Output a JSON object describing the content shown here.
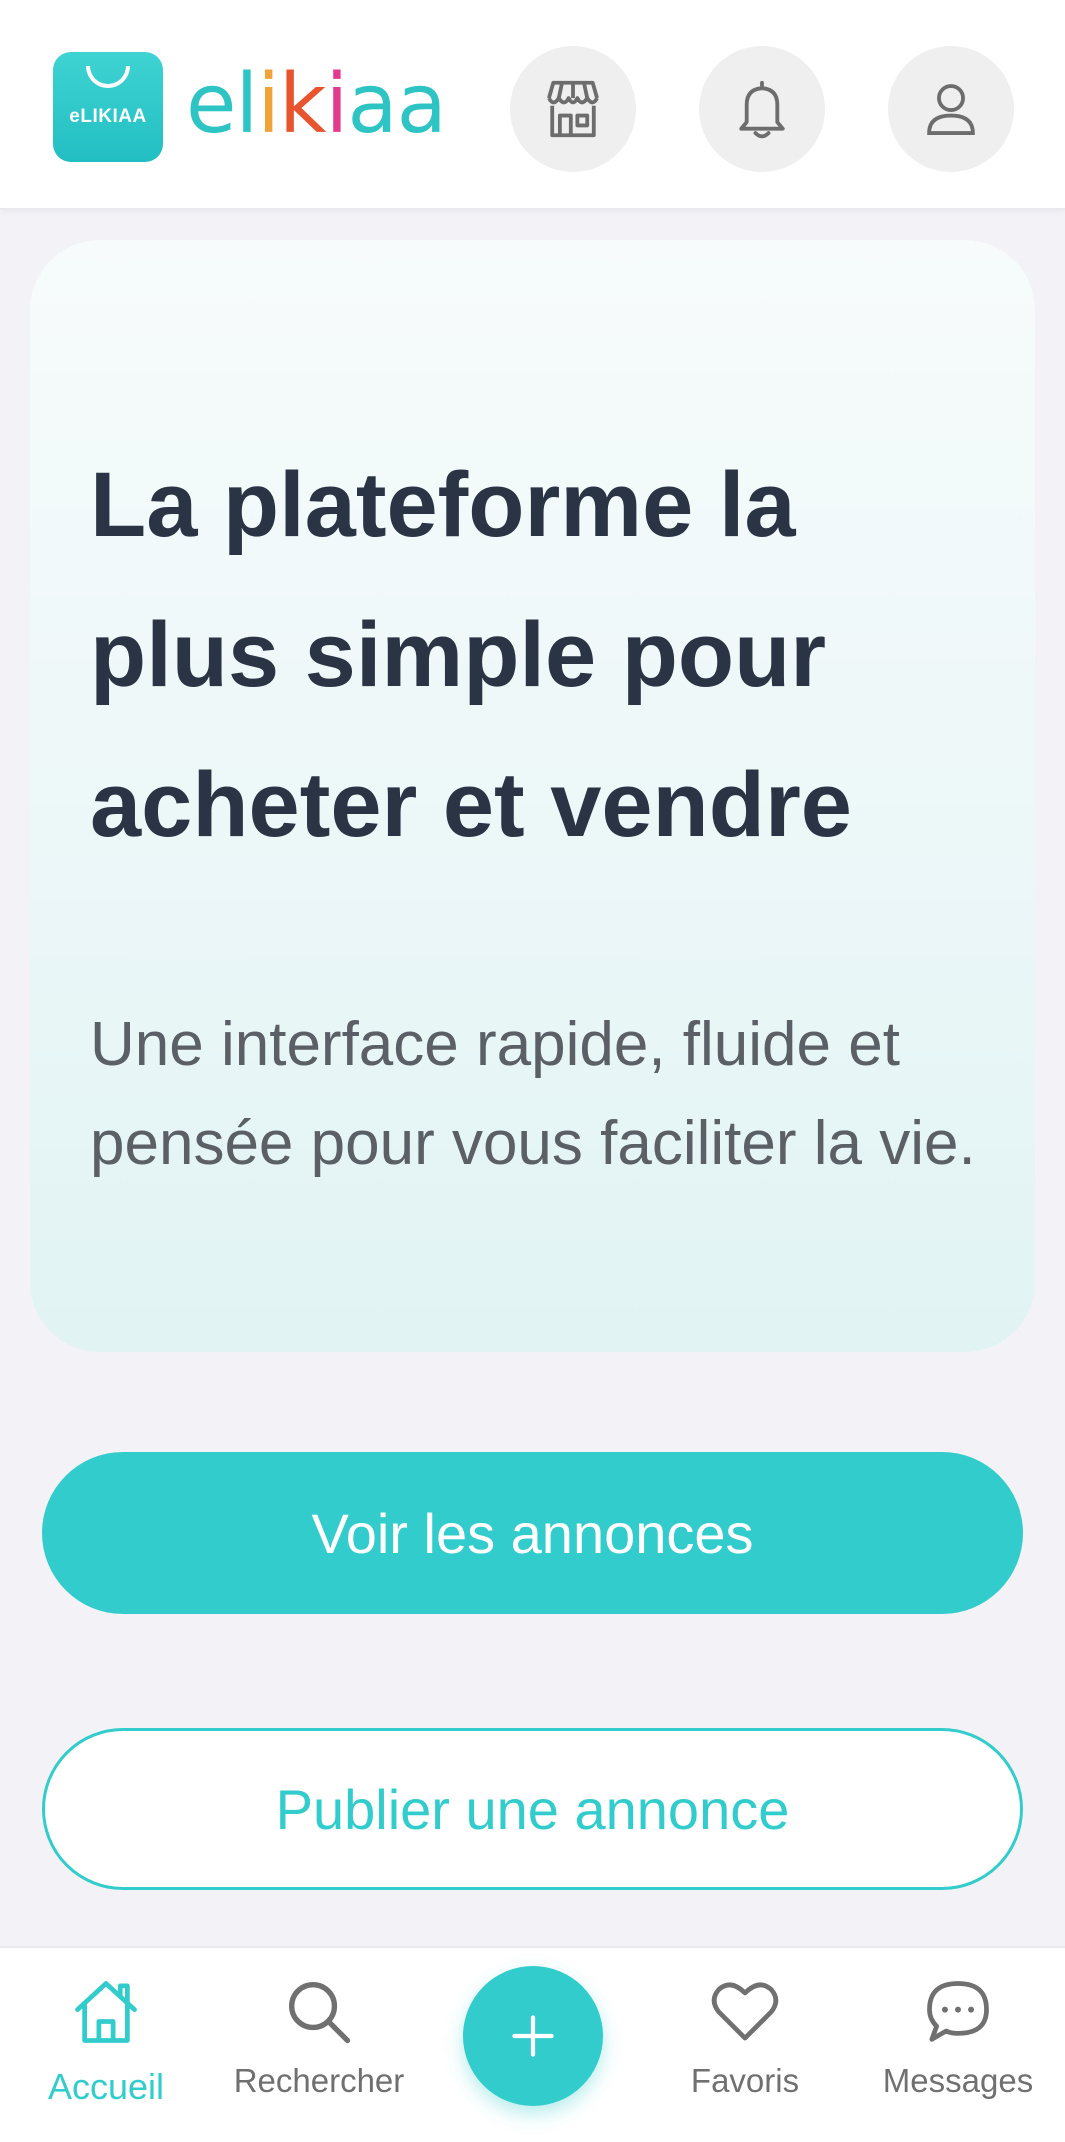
{
  "colors": {
    "accent": "#33cccc",
    "title_text": "#2b3445",
    "subtitle_text": "#5b5f66",
    "nav_inactive": "#707070",
    "background": "#f3f2f7"
  },
  "header": {
    "logo_icon_text": "eLIKIAA",
    "brand_letters": [
      {
        "char": "e",
        "color": "#2ec4c4"
      },
      {
        "char": "l",
        "color": "#2ec4c4"
      },
      {
        "char": "i",
        "color": "#f0a33a"
      },
      {
        "char": "k",
        "color": "#e8542e"
      },
      {
        "char": "i",
        "color": "#e23a8e"
      },
      {
        "char": "a",
        "color": "#2ec4c4"
      },
      {
        "char": "a",
        "color": "#2ec4c4"
      }
    ],
    "actions": [
      {
        "icon": "store-icon"
      },
      {
        "icon": "bell-icon"
      },
      {
        "icon": "user-icon"
      }
    ]
  },
  "hero": {
    "title": "La plateforme la plus simple pour acheter et vendre",
    "subtitle": "Une interface rapide, fluide et pensée pour vous faciliter la vie."
  },
  "buttons": {
    "primary_label": "Voir les annonces",
    "secondary_label": "Publier une annonce"
  },
  "bottom_nav": {
    "items": [
      {
        "label": "Accueil",
        "icon": "home-icon",
        "active": true
      },
      {
        "label": "Rechercher",
        "icon": "search-icon",
        "active": false
      },
      {
        "label": "Favoris",
        "icon": "heart-icon",
        "active": false
      },
      {
        "label": "Messages",
        "icon": "chat-bubble-icon",
        "active": false
      }
    ],
    "fab_icon": "plus-icon"
  }
}
